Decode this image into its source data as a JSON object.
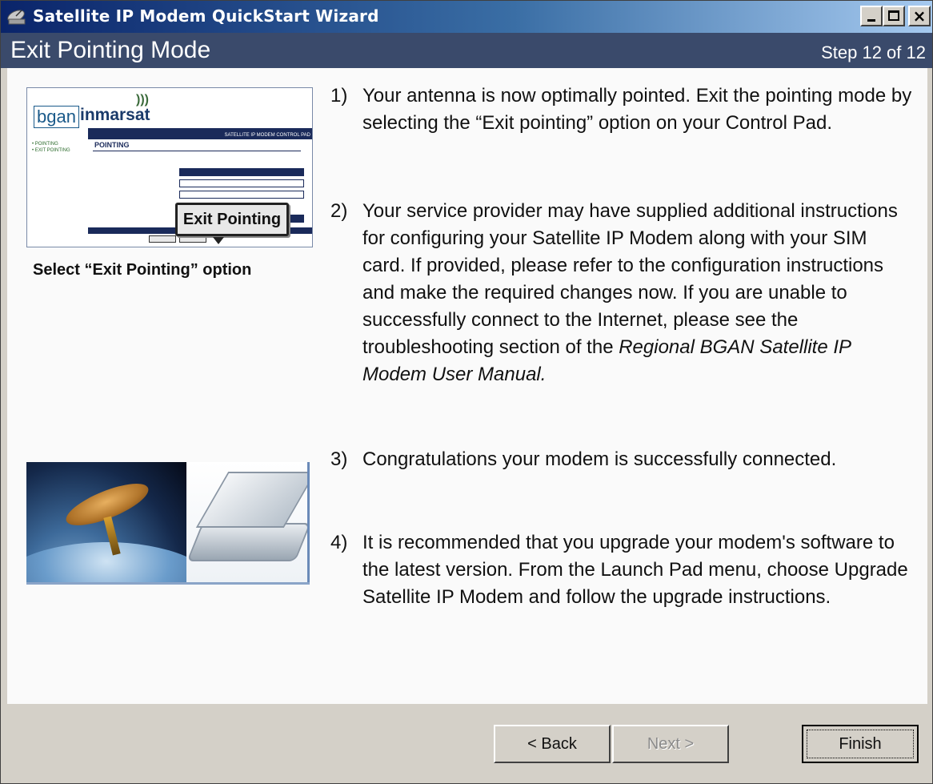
{
  "window": {
    "title": "Satellite IP Modem QuickStart Wizard",
    "icon": "satellite-dish-icon",
    "controls": {
      "minimize": "_",
      "maximize": "□",
      "close": "×"
    }
  },
  "header": {
    "title": "Exit Pointing Mode",
    "step": "Step 12 of 12"
  },
  "left_panel": {
    "screenshot": {
      "logo_left": "bgan",
      "logo_right": "inmarsat",
      "bar_text": "SATELLITE IP MODEM CONTROL PAD",
      "nav": [
        "• POINTING",
        "• EXIT POINTING"
      ],
      "section_title": "POINTING",
      "callout": "Exit Pointing"
    },
    "caption": "Select “Exit Pointing” option",
    "photo": "satellite-and-modem-image"
  },
  "steps": [
    {
      "num": "1)",
      "text": "Your antenna is now optimally pointed.  Exit the pointing mode by selecting the “Exit pointing” option on your Control Pad."
    },
    {
      "num": "2)",
      "text": "Your service provider may have supplied additional instructions for configuring your Satellite IP Modem along with your SIM card. If provided, please refer to the configuration instructions and make the required changes now.  If you are unable to successfully connect to the Internet, please see the troubleshooting section of the ",
      "italic": "Regional BGAN Satellite IP Modem User Manual."
    },
    {
      "num": "3)",
      "text": "Congratulations your modem is successfully connected."
    },
    {
      "num": "4)",
      "text": "It is recommended that you upgrade your modem's software to the latest version.  From the Launch Pad menu, choose Upgrade Satellite IP Modem and follow the upgrade instructions."
    }
  ],
  "buttons": {
    "back": "< Back",
    "next": "Next >",
    "finish": "Finish"
  }
}
